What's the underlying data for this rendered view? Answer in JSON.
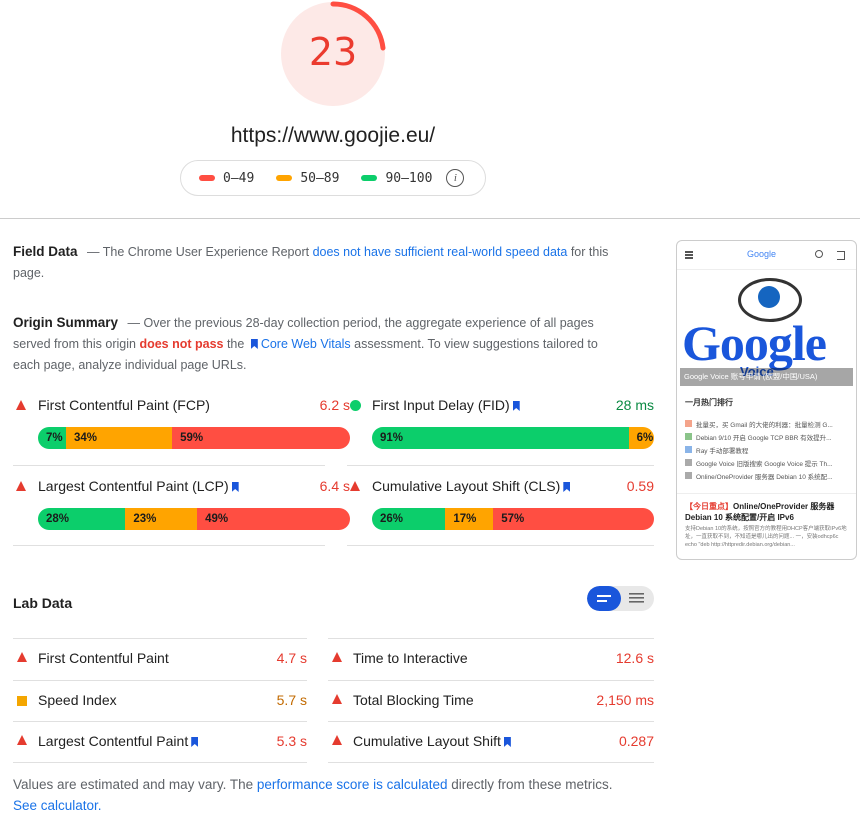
{
  "score": {
    "value": "23",
    "color": "#eb3b2f"
  },
  "url": "https://www.goojie.eu/",
  "legend": [
    {
      "label": "0–49",
      "color": "#ff4e42"
    },
    {
      "label": "50–89",
      "color": "#ffa400"
    },
    {
      "label": "90–100",
      "color": "#0cce6b"
    }
  ],
  "field": {
    "title": "Field Data",
    "text_a": "— The Chrome User Experience Report ",
    "link": "does not have sufficient real-world speed data",
    "text_b": " for this page."
  },
  "origin": {
    "title": "Origin Summary",
    "text_a": "— Over the previous 28-day collection period, the aggregate experience of all pages served from this origin ",
    "fail": "does not pass",
    "text_b": " the ",
    "link": "Core Web Vitals",
    "text_c": " assessment. To view suggestions tailored to each page, analyze individual page URLs."
  },
  "origin_metrics": [
    {
      "name": "First Contentful Paint (FCP)",
      "value": "6.2 s",
      "status": "fail",
      "good": "7%",
      "avg": "34%",
      "poor": "59%",
      "good_pct": 7,
      "avg_pct": 34,
      "poor_pct": 59
    },
    {
      "name": "First Input Delay (FID)",
      "value": "28 ms",
      "status": "pass",
      "good": "91%",
      "avg": "6%",
      "poor": "3%",
      "good_pct": 91,
      "avg_pct": 6,
      "poor_pct": 3
    },
    {
      "name": "Largest Contentful Paint (LCP)",
      "value": "6.4 s",
      "status": "fail",
      "good": "28%",
      "avg": "23%",
      "poor": "49%",
      "good_pct": 28,
      "avg_pct": 23,
      "poor_pct": 49
    },
    {
      "name": "Cumulative Layout Shift (CLS)",
      "value": "0.59",
      "status": "fail",
      "good": "26%",
      "avg": "17%",
      "poor": "57%",
      "good_pct": 26,
      "avg_pct": 17,
      "poor_pct": 57
    }
  ],
  "lab": {
    "title": "Lab Data",
    "metrics": [
      {
        "name": "First Contentful Paint",
        "value": "4.7 s"
      },
      {
        "name": "Time to Interactive",
        "value": "12.6 s"
      },
      {
        "name": "Speed Index",
        "value": "5.7 s"
      },
      {
        "name": "Total Blocking Time",
        "value": "2,150 ms"
      },
      {
        "name": "Largest Contentful Paint",
        "value": "5.3 s"
      },
      {
        "name": "Cumulative Layout Shift",
        "value": "0.287"
      }
    ],
    "footer_a": "Values are estimated and may vary. The ",
    "footer_link1": "performance score is calculated",
    "footer_b": " directly from these metrics. ",
    "footer_link2": "See calculator."
  },
  "thumbnail": {
    "brand": "Google",
    "word": "Google",
    "sub": "Voice",
    "caption": "Google Voice 账号申请 (欧盟/中国/USA)",
    "list_title": "一月热门排行",
    "list": [
      "批量买，买 Gmail 的大佬的利器：批量检测 G...",
      "Debian 9/10 开启 Google TCP BBR 有效提升...",
      "Ray 手动部署教程",
      "Google Voice 旧版搜索 Google Voice 提示 Th...",
      "Online/OneProvider 服务器 Debian 10 系统配..."
    ],
    "post_tag": "【今日重点】",
    "post_title": "Online/OneProvider 服务器 Debian 10 系统配置/开启 IPv6",
    "post_excerpt": "支持Debian 10的系统，按照官方的教程用DHCP客户端获取IPv6地址，一直获取不到，不知道是哪儿出的问题... 一，安装odhcp6c echo \"deb http://httpredir.debian.org/debian..."
  }
}
